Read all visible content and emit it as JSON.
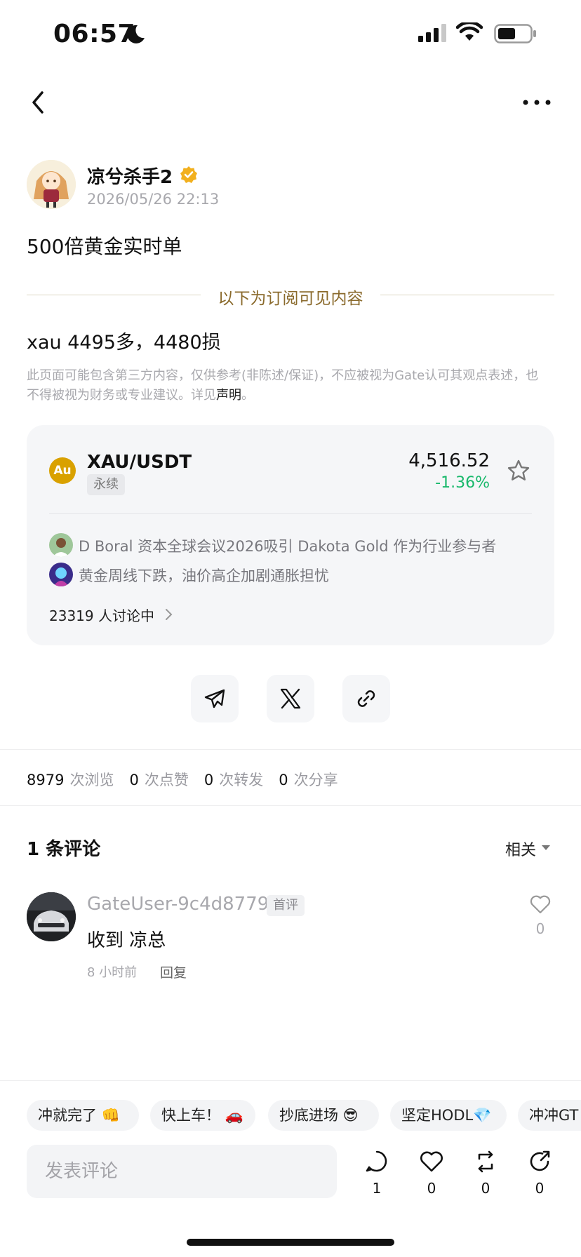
{
  "status_bar": {
    "time": "06:57"
  },
  "post": {
    "author": "凉兮杀手2",
    "date": "2026/05/26 22:13",
    "title": "500倍黄金实时单",
    "subscription_divider": "以下为订阅可见内容",
    "body": "xau 4495多，4480损",
    "disclaimer": "此页面可能包含第三方内容，仅供参考(非陈述/保证)，不应被视为Gate认可其观点表述，也不得被视为财务或专业建议。详见",
    "disclaimer_link": "声明",
    "disclaimer_end": "。"
  },
  "ticker_card": {
    "coin_icon": "Au",
    "pair": "XAU/USDT",
    "type_tag": "永续",
    "price": "4,516.52",
    "change": "-1.36%",
    "change_color": "#18b86b",
    "coin_color": "#d9a100",
    "news": [
      {
        "text": "D Boral 资本全球会议2026吸引 Dakota Gold 作为行业参与者"
      },
      {
        "text": "黄金周线下跌，油价高企加剧通胀担忧"
      }
    ],
    "discussion": "23319 人讨论中"
  },
  "share": {
    "icons": [
      "telegram-icon",
      "x-icon",
      "link-icon"
    ]
  },
  "stats": [
    {
      "value": "8979",
      "unit": "次浏览"
    },
    {
      "value": "0",
      "unit": "次点赞"
    },
    {
      "value": "0",
      "unit": "次转发"
    },
    {
      "value": "0",
      "unit": "次分享"
    }
  ],
  "comments": {
    "title": "1 条评论",
    "sort": "相关",
    "items": [
      {
        "user": "GateUser-9c4d8779",
        "badge": "首评",
        "text": "收到 凉总",
        "time": "8 小时前",
        "reply": "回复",
        "likes": "0"
      }
    ]
  },
  "quick_replies": [
    "冲就完了 👊",
    "快上车！ 🚗",
    "抄底进场 😎",
    "坚定HODL💎",
    "冲冲GT"
  ],
  "bottom_bar": {
    "placeholder": "发表评论",
    "actions": [
      {
        "icon": "comment-icon",
        "count": "1"
      },
      {
        "icon": "heart-icon",
        "count": "0"
      },
      {
        "icon": "repost-icon",
        "count": "0"
      },
      {
        "icon": "share-icon",
        "count": "0"
      }
    ]
  }
}
